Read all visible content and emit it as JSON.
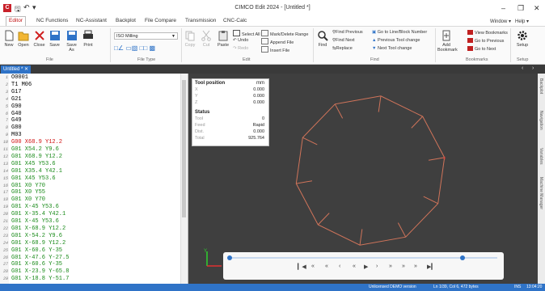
{
  "titlebar": {
    "title": "CIMCO Edit 2024 - [Untitled *]"
  },
  "menu": {
    "tabs": [
      "Editor",
      "NC Functions",
      "NC-Assistant",
      "Backplot",
      "File Compare",
      "Transmission",
      "CNC-Calc"
    ],
    "window": "Window",
    "help": "Help"
  },
  "ribbon": {
    "file": {
      "new": "New",
      "open": "Open",
      "close": "Close",
      "save": "Save",
      "save_as": "Save As",
      "print": "Print",
      "label": "File"
    },
    "file_type": {
      "selected": "ISO Milling",
      "label": "File Type"
    },
    "edit": {
      "copy": "Copy",
      "cut": "Cut",
      "paste": "Paste",
      "select_all": "Select All",
      "undo": "Undo",
      "redo": "Redo",
      "mark_delete": "Mark/Delete Range",
      "append": "Append File",
      "insert": "Insert File",
      "label": "Edit"
    },
    "find": {
      "find": "Find",
      "find_prev": "Find Previous",
      "find_next": "Find Next",
      "replace": "Replace",
      "goto_line": "Go to Line/Block Number",
      "prev_tool": "Previous Tool change",
      "next_tool": "Next Tool change",
      "label": "Find"
    },
    "bookmarks": {
      "add": "Add Bookmark",
      "view": "View Bookmarks",
      "goto_prev": "Go to Previous",
      "goto_next": "Go to Next",
      "label": "Bookmarks"
    },
    "setup": {
      "setup": "Setup",
      "label": "Setup"
    }
  },
  "doc_tab": "Untitled *",
  "code_lines": [
    {
      "n": "1",
      "t": "O0001",
      "c": "#000"
    },
    {
      "n": "2",
      "t": "T1 M06",
      "c": "#000"
    },
    {
      "n": "3",
      "t": "G17",
      "c": "#000"
    },
    {
      "n": "4",
      "t": "G21",
      "c": "#000"
    },
    {
      "n": "5",
      "t": "G90",
      "c": "#000"
    },
    {
      "n": "6",
      "t": "G40",
      "c": "#000"
    },
    {
      "n": "7",
      "t": "G49",
      "c": "#000"
    },
    {
      "n": "8",
      "t": "G80",
      "c": "#000"
    },
    {
      "n": "9",
      "t": "M03",
      "c": "#000"
    },
    {
      "n": "10",
      "t": "G00 X68.9 Y12.2",
      "c": "#d01010"
    },
    {
      "n": "11",
      "t": "G01 X54.2 Y9.6",
      "c": "#188a18"
    },
    {
      "n": "12",
      "t": "G01 X68.9 Y12.2",
      "c": "#188a18"
    },
    {
      "n": "13",
      "t": "G01 X45 Y53.6",
      "c": "#188a18"
    },
    {
      "n": "14",
      "t": "G01 X35.4 Y42.1",
      "c": "#188a18"
    },
    {
      "n": "15",
      "t": "G01 X45 Y53.6",
      "c": "#188a18"
    },
    {
      "n": "16",
      "t": "G01 X0 Y70",
      "c": "#188a18"
    },
    {
      "n": "17",
      "t": "G01 X0 Y55",
      "c": "#188a18"
    },
    {
      "n": "18",
      "t": "G01 X0 Y70",
      "c": "#188a18"
    },
    {
      "n": "19",
      "t": "G01 X-45 Y53.6",
      "c": "#188a18"
    },
    {
      "n": "20",
      "t": "G01 X-35.4 Y42.1",
      "c": "#188a18"
    },
    {
      "n": "21",
      "t": "G01 X-45 Y53.6",
      "c": "#188a18"
    },
    {
      "n": "22",
      "t": "G01 X-68.9 Y12.2",
      "c": "#188a18"
    },
    {
      "n": "23",
      "t": "G01 X-54.2 Y9.6",
      "c": "#188a18"
    },
    {
      "n": "24",
      "t": "G01 X-68.9 Y12.2",
      "c": "#188a18"
    },
    {
      "n": "25",
      "t": "G01 X-60.6 Y-35",
      "c": "#188a18"
    },
    {
      "n": "26",
      "t": "G01 X-47.6 Y-27.5",
      "c": "#188a18"
    },
    {
      "n": "27",
      "t": "G01 X-60.6 Y-35",
      "c": "#188a18"
    },
    {
      "n": "28",
      "t": "G01 X-23.9 Y-65.8",
      "c": "#188a18"
    },
    {
      "n": "29",
      "t": "G01 X-18.8 Y-51.7",
      "c": "#188a18"
    }
  ],
  "tool_panel": {
    "title": "Tool position",
    "unit": "mm",
    "x_label": "X",
    "x": "0.000",
    "y_label": "Y",
    "y": "0.000",
    "z_label": "Z",
    "z": "0.000",
    "status_title": "Status",
    "tool_label": "Tool",
    "tool": "0",
    "feed_label": "Feed",
    "feed": "Rapid",
    "dist_label": "Dist.",
    "dist": "0.000",
    "total_label": "Total",
    "total": "925.764"
  },
  "sidebar_tabs": [
    "Backplot",
    "Navigation",
    "Variables",
    "Machine Manager"
  ],
  "status": {
    "demo": "Unlicensed DEMO version",
    "position": "Ln 1/39, Col 6, 472 bytes",
    "mode": "INS",
    "time": "13:04:20"
  },
  "colors": {
    "accent": "#2f73c7",
    "toolpath": "#d0745a",
    "code_rapid": "#d01010",
    "code_feed": "#188a18"
  },
  "player": {
    "progress_left": 0.0,
    "progress_right": 0.87
  }
}
